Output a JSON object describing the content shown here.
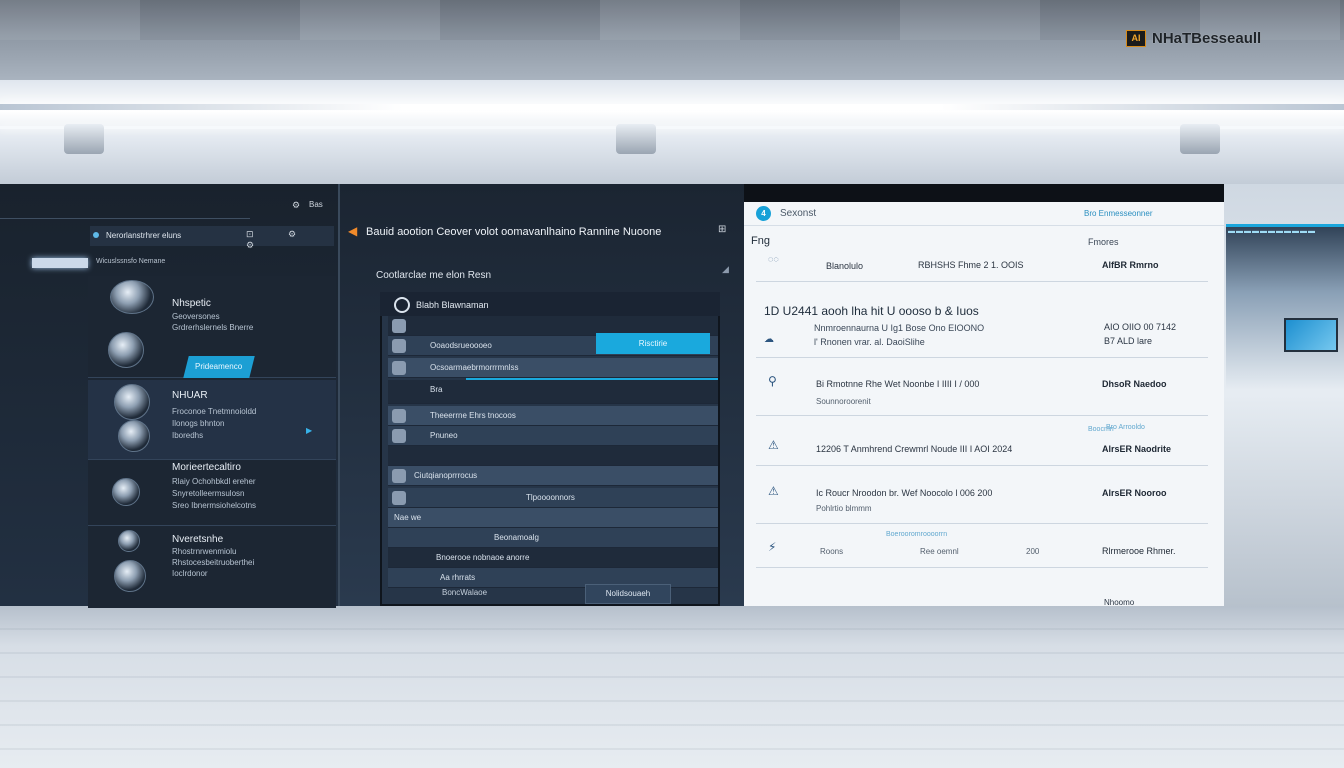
{
  "brand": {
    "badge": "AI",
    "text": "NHaTBesseaull"
  },
  "panel_a": {
    "top_icon": "⚙",
    "top_label": "Bas",
    "header_label": "Nerorlanstrhrer eluns",
    "header_icons": "⊡ ⚙ ⚙",
    "sub_label": "Wicuslssnsfo Nemane",
    "cta": "Prideamenco",
    "cards": [
      {
        "name": "Nhspetic",
        "desc1": "Geoversones",
        "desc2": "Grdrerhslernels Bnerre"
      },
      {
        "name": "NHUAR",
        "desc1": "Froconoe Tnetmnoioldd",
        "desc2": "Ilonogs bhnton",
        "desc3": "Iboredhs"
      },
      {
        "name": "Morieertecaltiro",
        "desc1": "Rlaiy Ochohbkdl ereher",
        "desc2": "Snyretolleermsulosn",
        "desc3": "Sreo Ibnermsiohelcotns"
      },
      {
        "name": "Nveretsnhe",
        "desc1": "Rhostrnrwenmiolu",
        "desc2": "Rhstocesbeitruoberthei",
        "desc3": "Ioclrdonor"
      }
    ]
  },
  "panel_b": {
    "title": "Bauid aootion Ceover volot oomavanlhaino Rannine Nuoone",
    "title_icon": "⊞",
    "section": "Cootlarclae me elon Resn",
    "frame_title": "Blabh Blawnaman",
    "accent_label": "Risctirie",
    "rows": [
      "Ooaodsrueoooeo",
      "Ocsoarmaebrmorrrmnlss",
      "Bra",
      "Theeerrne Ehrs tnocoos",
      "Pnuneo",
      "Ciutqianoprrrocus",
      "Tlpoooonnors",
      "Nae we",
      "Beonamoalg",
      "Bnoerooe nobnaoe anorre",
      "Aa rhrrats"
    ],
    "footer_link": "BoncWalaoe",
    "button": "Nolidsouaeh"
  },
  "panel_c": {
    "logo": "4",
    "brand": "Sexonst",
    "head_link": "Bro Enmesseonner",
    "label": "Fng",
    "col_head": "Fmores",
    "top_row": {
      "col1": "Blanolulo",
      "col2": "RBHSHS Fhme 2 1. OOIS",
      "status": "AlfBR Rmrno"
    },
    "big": "1D U2441 aooh lha hit U oooso b & Iuos",
    "big_sub1": "Nnmroennaurna U Ig1 Bose Ono EIOONO",
    "big_sub2": "l' Rnonen vrar. al. DaoiSlihe",
    "right_num1": "AIO OIIO 00 7142",
    "right_num2": "B7 ALD lare",
    "rows": [
      {
        "icon": "⚲",
        "text": "Bi Rmotnne Rhe Wet Noonbe I IIII I / 000",
        "sub": "Sounnoroorenit",
        "status": "DhsoR Naedoo",
        "hint": ""
      },
      {
        "icon": "⚠",
        "text": "12206 T Anmhrend Crewmrl Noude III I AOI 2024",
        "sub": "",
        "status": "AlrsER Naodrite",
        "hint": "Bro Arrooldo"
      },
      {
        "icon": "⚠",
        "text": "Ic Roucr Nroodon br. Wef Noocolo l 006 200",
        "sub": "Pohlrtio blmmm",
        "status": "AlrsER Nooroo",
        "hint": ""
      },
      {
        "icon": "⚡",
        "text": "Roons",
        "sub": "",
        "status": "Rlrmerooe Rhmer.",
        "hint": "Boerooromroooorrn"
      }
    ],
    "extra_status": "Boocmn",
    "row4_col2": "Ree oemnl",
    "row4_col3": "200",
    "foot": "Nhoomo"
  },
  "colors": {
    "accent": "#1aa9dd",
    "orange": "#f08a2a",
    "dark": "#1b2532"
  }
}
